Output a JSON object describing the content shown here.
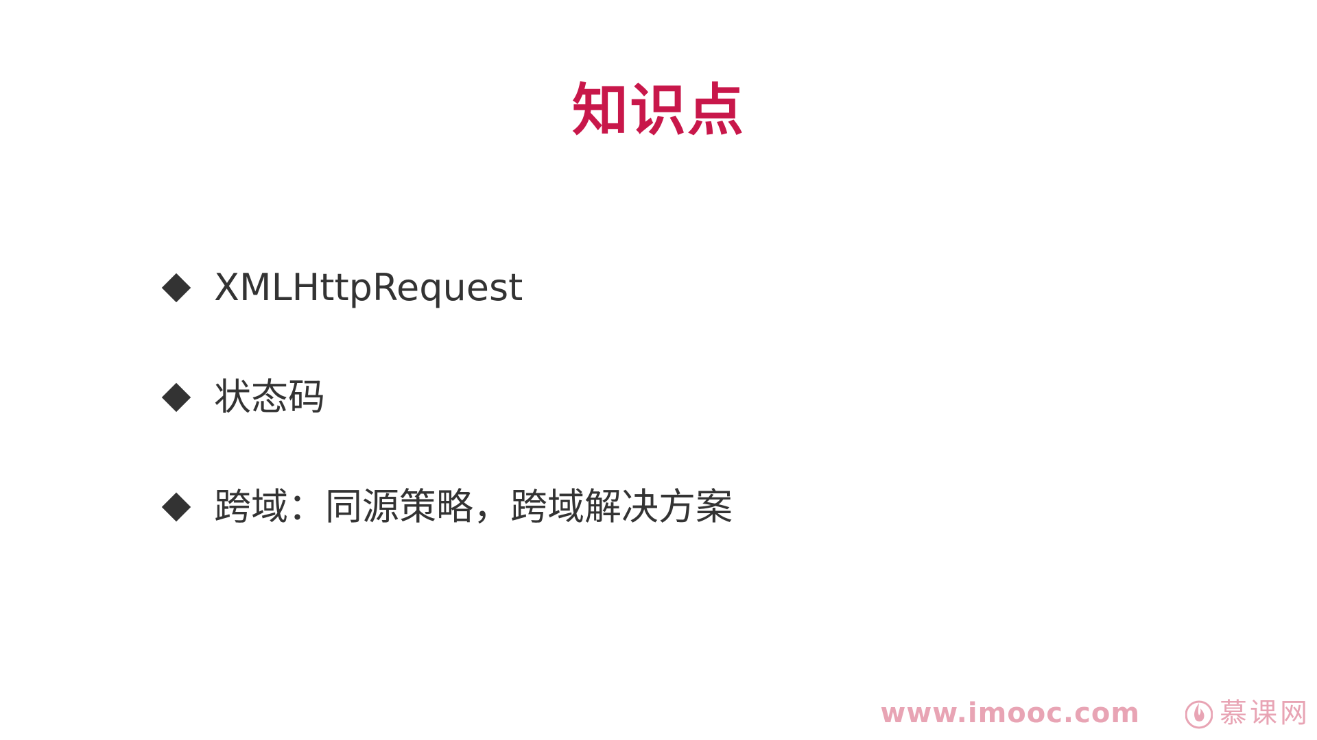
{
  "slide": {
    "title": "知识点",
    "bullets": [
      "XMLHttpRequest",
      "状态码",
      "跨域：同源策略，跨域解决方案"
    ]
  },
  "footer": {
    "url": "www.imooc.com",
    "brand": "慕课网",
    "logo_icon": "flame-icon"
  },
  "colors": {
    "title": "#c8174a",
    "text": "#333333",
    "watermark": "#e8a4b4"
  }
}
